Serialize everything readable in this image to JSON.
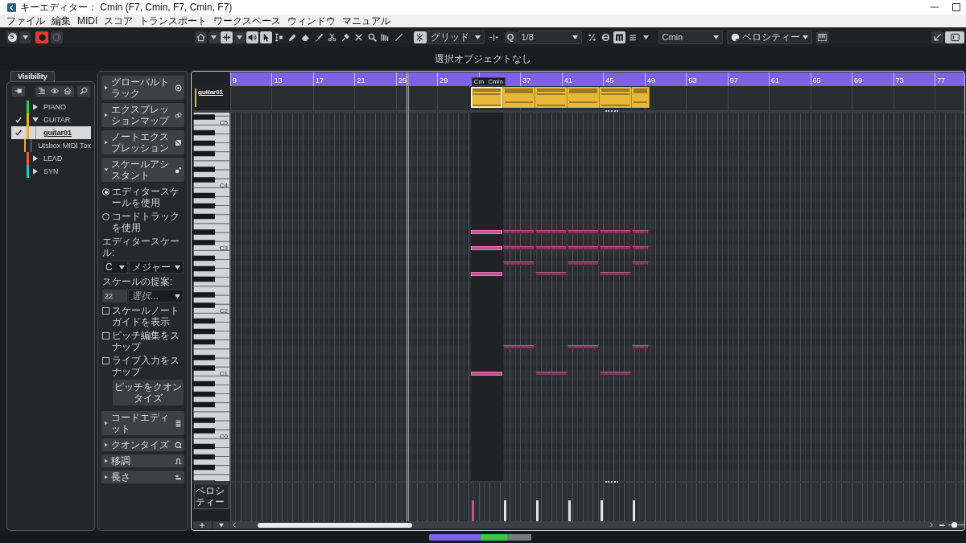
{
  "window": {
    "title": "キーエディター： Cmin (F7, Cmin, F7, Cmin, F7)"
  },
  "menu": [
    "ファイル",
    "編集",
    "MIDI",
    "スコア",
    "トランスポート",
    "ワークスペース",
    "ウィンドウ",
    "マニュアル"
  ],
  "toolbar": {
    "solo": {
      "label": "S"
    },
    "record": {
      "on": true
    },
    "monitor": {
      "on": false
    },
    "tools": [
      {
        "on": false
      },
      {
        "on": true
      },
      {
        "on": true
      },
      {
        "on": true
      },
      {
        "on": false
      },
      {
        "on": false
      },
      {
        "on": false
      },
      {
        "on": false
      },
      {
        "on": false
      },
      {
        "on": false
      },
      {
        "on": false
      },
      {
        "on": false
      },
      {
        "on": false
      },
      {
        "on": false
      }
    ],
    "snap": {
      "on": true,
      "value": "グリッド"
    },
    "quantize": {
      "label": "Q",
      "value": "1/8"
    },
    "modes": [
      {
        "on": false
      },
      {
        "on": false
      },
      {
        "on": true
      },
      {
        "on": false
      }
    ],
    "chord": {
      "value": "Cmin"
    },
    "controller": {
      "value": "ベロシティー"
    },
    "right": [
      {
        "on": false
      },
      {
        "on": true
      }
    ]
  },
  "status_line": "選択オブジェクトなし",
  "visibility": {
    "tabs": [
      {
        "label": "Visibility",
        "selected": true
      }
    ],
    "tracks": [
      {
        "name": "PIANO",
        "color": "#2fcf55",
        "checked": false,
        "selected": false,
        "expanded": false
      },
      {
        "name": "GUITAR",
        "color": "#e8b030",
        "checked": true,
        "selected": false,
        "expanded": true,
        "children": [
          {
            "name": "guitar01",
            "checked": true,
            "selected": true
          },
          {
            "name": "Utsbox MIDI Tox",
            "checked": false,
            "selected": false
          }
        ]
      },
      {
        "name": "LEAD",
        "color": "#e0623a",
        "checked": false,
        "selected": false,
        "expanded": false
      },
      {
        "name": "SYN",
        "color": "#22c1cc",
        "checked": false,
        "selected": false,
        "expanded": false
      }
    ]
  },
  "inspector": {
    "sections": [
      {
        "label": "グローバルトラック",
        "expanded": false
      },
      {
        "label": "エクスプレッションマップ",
        "expanded": false
      },
      {
        "label": "ノートエクスプレッション",
        "expanded": false
      },
      {
        "label": "スケールアシスタント",
        "expanded": true,
        "content": {
          "radios": [
            {
              "label": "エディタースケールを使用",
              "selected": true
            },
            {
              "label": "コードトラックを使用",
              "selected": false
            }
          ],
          "scale_label": "エディタースケール:",
          "root": "C",
          "scale": "メジャー",
          "suggest_label": "スケールの提案:",
          "suggest_count": "22",
          "suggest_placeholder": "選択...",
          "checkboxes": [
            {
              "label": "スケールノートガイドを表示",
              "checked": false
            },
            {
              "label": "ピッチ編集をスナップ",
              "checked": false
            },
            {
              "label": "ライブ入力をスナップ",
              "checked": false
            }
          ],
          "button": "ピッチをクオンタイズ"
        }
      },
      {
        "label": "コードエディット",
        "expanded": false
      },
      {
        "label": "クオンタイズ",
        "expanded": false
      },
      {
        "label": "移調",
        "expanded": false
      },
      {
        "label": "長さ",
        "expanded": false
      }
    ]
  },
  "editor": {
    "ruler": {
      "bars_before": [
        "9",
        "13",
        "17",
        "21",
        "25",
        "29"
      ],
      "chord_labels": [
        "Cm",
        "Cmin"
      ],
      "bars_after": [
        "37",
        "41",
        "45",
        "49",
        "53",
        "57",
        "61",
        "65",
        "69",
        "73",
        "77"
      ]
    },
    "event_track": {
      "name": "guitar01"
    },
    "chord_events": [
      {
        "kind": "cmin",
        "selected": true
      },
      {
        "kind": "f7",
        "selected": false
      },
      {
        "kind": "cmin",
        "selected": false
      },
      {
        "kind": "f7",
        "selected": false
      },
      {
        "kind": "cmin",
        "selected": false
      },
      {
        "kind": "f7",
        "selected": false
      }
    ],
    "keyboard": {
      "octave_labels": [
        "C5",
        "C4",
        "C3",
        "C2",
        "C1",
        "C0"
      ]
    },
    "velocity_lane": {
      "label": "ベロシティー"
    },
    "zoom_slider": {
      "level": 0.35
    }
  }
}
